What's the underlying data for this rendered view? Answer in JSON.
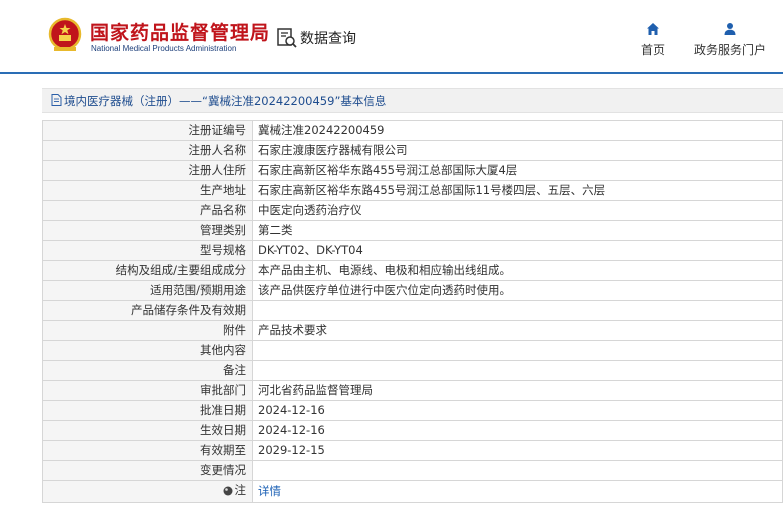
{
  "header": {
    "logo_cn": "国家药品监督管理局",
    "logo_en": "National Medical Products Administration",
    "data_query": "数据查询",
    "nav": {
      "home": "首页",
      "portal": "政务服务门户"
    }
  },
  "breadcrumb": "境内医疗器械（注册）——“冀械注准20242200459”基本信息",
  "rows": [
    {
      "key": "注册证编号",
      "value": "冀械注准20242200459"
    },
    {
      "key": "注册人名称",
      "value": "石家庄渡康医疗器械有限公司"
    },
    {
      "key": "注册人住所",
      "value": "石家庄高新区裕华东路455号润江总部国际大厦4层"
    },
    {
      "key": "生产地址",
      "value": "石家庄高新区裕华东路455号润江总部国际11号楼四层、五层、六层"
    },
    {
      "key": "产品名称",
      "value": "中医定向透药治疗仪"
    },
    {
      "key": "管理类别",
      "value": "第二类"
    },
    {
      "key": "型号规格",
      "value": "DK-YT02、DK-YT04"
    },
    {
      "key": "结构及组成/主要组成成分",
      "value": "本产品由主机、电源线、电极和相应输出线组成。"
    },
    {
      "key": "适用范围/预期用途",
      "value": "该产品供医疗单位进行中医穴位定向透药时使用。"
    },
    {
      "key": "产品储存条件及有效期",
      "value": ""
    },
    {
      "key": "附件",
      "value": "产品技术要求"
    },
    {
      "key": "其他内容",
      "value": ""
    },
    {
      "key": "备注",
      "value": ""
    },
    {
      "key": "审批部门",
      "value": "河北省药品监督管理局"
    },
    {
      "key": "批准日期",
      "value": "2024-12-16"
    },
    {
      "key": "生效日期",
      "value": "2024-12-16"
    },
    {
      "key": "有效期至",
      "value": "2029-12-15"
    },
    {
      "key": "变更情况",
      "value": ""
    }
  ],
  "note": {
    "key": "注",
    "link": "详情"
  },
  "colors": {
    "brand_red": "#c0141b",
    "brand_blue": "#2a6db5",
    "link": "#1a5fb4"
  }
}
